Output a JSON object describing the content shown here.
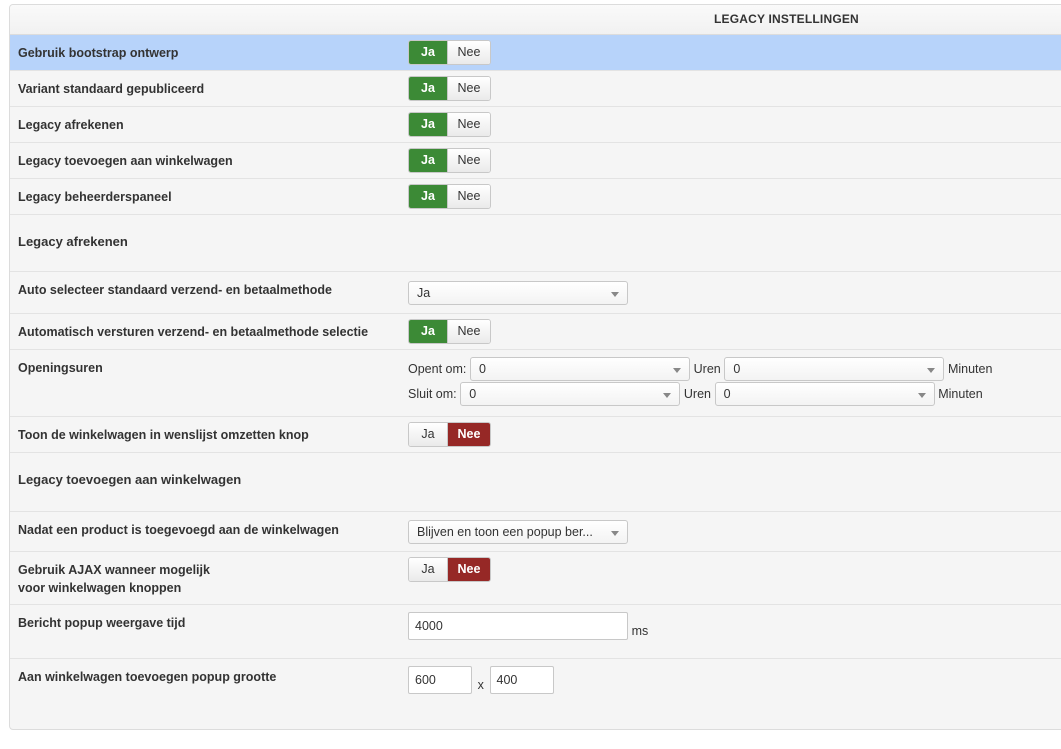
{
  "header": {
    "title": "LEGACY INSTELLINGEN"
  },
  "toggle_labels": {
    "yes": "Ja",
    "no": "Nee"
  },
  "settings": {
    "bootstrap": {
      "label": "Gebruik bootstrap ontwerp",
      "value": "Ja"
    },
    "variant": {
      "label": "Variant standaard gepubliceerd",
      "value": "Ja"
    },
    "checkout": {
      "label": "Legacy afrekenen",
      "value": "Ja"
    },
    "add_to_cart": {
      "label": "Legacy toevoegen aan winkelwagen",
      "value": "Ja"
    },
    "admin_panel": {
      "label": "Legacy beheerderspaneel",
      "value": "Ja"
    }
  },
  "section_checkout": {
    "title": "Legacy afrekenen",
    "auto_select": {
      "label": "Auto selecteer standaard verzend- en betaalmethode",
      "value": "Ja"
    },
    "auto_send": {
      "label": "Automatisch versturen verzend- en betaalmethode selectie",
      "value": "Ja"
    },
    "opening_hours": {
      "label": "Openingsuren",
      "opens_label": "Opent om:",
      "closes_label": "Sluit om:",
      "hours_label": "Uren",
      "minutes_label": "Minuten",
      "open_hour": "0",
      "open_minute": "0",
      "close_hour": "0",
      "close_minute": "0"
    },
    "wishlist_button": {
      "label": "Toon de winkelwagen in wenslijst omzetten knop",
      "value": "Nee"
    }
  },
  "section_add_to_cart": {
    "title": "Legacy toevoegen aan winkelwagen",
    "after_add": {
      "label": "Nadat een product is toegevoegd aan de winkelwagen",
      "value": "Blijven en toon een popup ber..."
    },
    "ajax": {
      "label_line1": "Gebruik AJAX wanneer mogelijk",
      "label_line2": "voor winkelwagen knoppen",
      "value": "Nee"
    },
    "popup_time": {
      "label": "Bericht popup weergave tijd",
      "value": "4000",
      "unit": "ms"
    },
    "popup_size": {
      "label": "Aan winkelwagen toevoegen popup grootte",
      "width": "600",
      "separator": "x",
      "height": "400"
    }
  },
  "colors": {
    "yes_active": "#3c8a36",
    "no_active": "#962826",
    "row_highlight": "#b7d3fa"
  }
}
